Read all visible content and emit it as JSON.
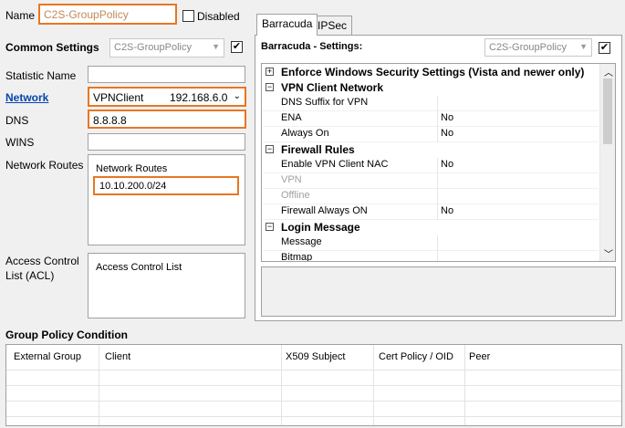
{
  "name_label": "Name",
  "name_value": "C2S-GroupPolicy",
  "disabled_label": "Disabled",
  "common_settings": {
    "label": "Common Settings",
    "combo_value": "C2S-GroupPolicy",
    "checked": "✔"
  },
  "fields": {
    "statistic_name_label": "Statistic Name",
    "statistic_name_value": "",
    "network_label": "Network",
    "network_value": "VPNClient",
    "network_ip": "192.168.6.0",
    "dns_label": "DNS",
    "dns_value": "8.8.8.8",
    "wins_label": "WINS",
    "wins_value": "",
    "network_routes_label": "Network Routes",
    "network_routes_header": "Network Routes",
    "network_routes_items": [
      "10.10.200.0/24"
    ],
    "acl_label_line1": "Access Control",
    "acl_label_line2": "List (ACL)",
    "acl_header": "Access Control List"
  },
  "tabs": [
    {
      "label": "Barracuda",
      "active": true
    },
    {
      "label": "IPSec",
      "active": false
    }
  ],
  "barracuda_settings": {
    "label": "Barracuda - Settings:",
    "combo_value": "C2S-GroupPolicy",
    "checked": "✔"
  },
  "property_grid": [
    {
      "kind": "cat",
      "name": "Enforce Windows Security Settings (Vista and newer only)",
      "toggle": "+"
    },
    {
      "kind": "cat",
      "name": "VPN Client Network",
      "toggle": "−"
    },
    {
      "kind": "item",
      "name": "DNS Suffix for VPN",
      "value": ""
    },
    {
      "kind": "item",
      "name": "ENA",
      "value": "No"
    },
    {
      "kind": "item",
      "name": "Always On",
      "value": "No"
    },
    {
      "kind": "cat",
      "name": "Firewall Rules",
      "toggle": "−"
    },
    {
      "kind": "item",
      "name": "Enable VPN Client NAC",
      "value": "No"
    },
    {
      "kind": "item",
      "name": "VPN",
      "value": "",
      "disabled": true
    },
    {
      "kind": "item",
      "name": "Offline",
      "value": "",
      "disabled": true
    },
    {
      "kind": "item",
      "name": "Firewall Always ON",
      "value": "No"
    },
    {
      "kind": "cat",
      "name": "Login Message",
      "toggle": "−"
    },
    {
      "kind": "item",
      "name": "Message",
      "value": ""
    },
    {
      "kind": "item",
      "name": "Bitmap",
      "value": ""
    }
  ],
  "group_policy_condition": {
    "label": "Group Policy Condition",
    "columns": [
      "External Group",
      "Client",
      "X509 Subject",
      "Cert Policy / OID",
      "Peer"
    ]
  }
}
